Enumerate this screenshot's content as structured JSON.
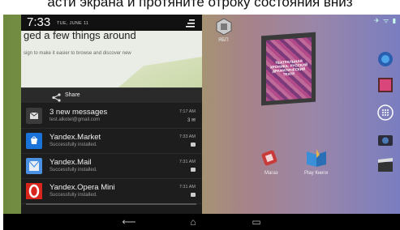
{
  "caption": "асти экрана и протяните отроку состояния вниз",
  "status": {
    "icons": "✈ ᯤ ▮"
  },
  "shade": {
    "time": "7:33",
    "date": "TUE, JUNE 11",
    "settings_icon": "settings-sliders-icon"
  },
  "expanded_notification": {
    "title": "ged a few things around",
    "subtitle": "sign to make it easier to browse and discover new"
  },
  "share": {
    "label": "Share"
  },
  "notifications": [
    {
      "title": "3 new messages",
      "text": "test.alkotel@gmail.com",
      "time": "7:17 AM",
      "count": "3",
      "icon": "email-icon",
      "color": "#3b3b3b"
    },
    {
      "title": "Yandex.Market",
      "text": "Successfully installed.",
      "time": "7:33 AM",
      "count": "",
      "icon": "yandex-market-icon",
      "color": "#1a73d9"
    },
    {
      "title": "Yandex.Mail",
      "text": "Successfully installed.",
      "time": "7:31 AM",
      "count": "",
      "icon": "yandex-mail-icon",
      "color": "#4a90e2"
    },
    {
      "title": "Yandex.Opera Mini",
      "text": "Successfully installed.",
      "time": "7:31 AM",
      "count": "",
      "icon": "opera-mini-icon",
      "color": "#d9261c"
    }
  ],
  "desktop": {
    "folder_label": "ЯБП",
    "book_title": "ТЕАТРАЛЬНАЯ ХРОНИКА: РУССКИЙ ДРАМАТИЧЕСКИЙ ТЕАТР",
    "app_labels": [
      "Магаз",
      "Play Книги"
    ]
  },
  "nav": {
    "back": "⟵",
    "home": "⌂",
    "recents": "▭"
  }
}
